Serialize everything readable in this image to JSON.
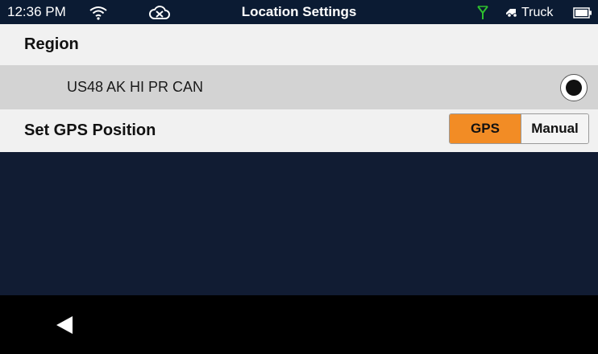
{
  "status_bar": {
    "time": "12:36 PM",
    "title": "Location Settings",
    "vehicle_label": "Truck",
    "icons": {
      "wifi": "wifi-icon",
      "cloud": "cloud-off-icon",
      "antenna": "antenna-icon",
      "truck": "truck-icon",
      "battery": "battery-icon"
    }
  },
  "region": {
    "title": "Region",
    "option_label": "US48 AK HI PR CAN",
    "selected": true
  },
  "gps": {
    "title": "Set GPS Position",
    "segments": [
      "GPS",
      "Manual"
    ],
    "selected": "GPS"
  },
  "nav": {
    "back_icon": "back-arrow-icon"
  },
  "colors": {
    "status_bar_bg": "#0b1b33",
    "content_bg": "#111c33",
    "accent": "#f28c25",
    "antenna_green": "#2ec02e",
    "row_bg": "#f1f1f1",
    "selected_row_bg": "#d3d3d3"
  }
}
